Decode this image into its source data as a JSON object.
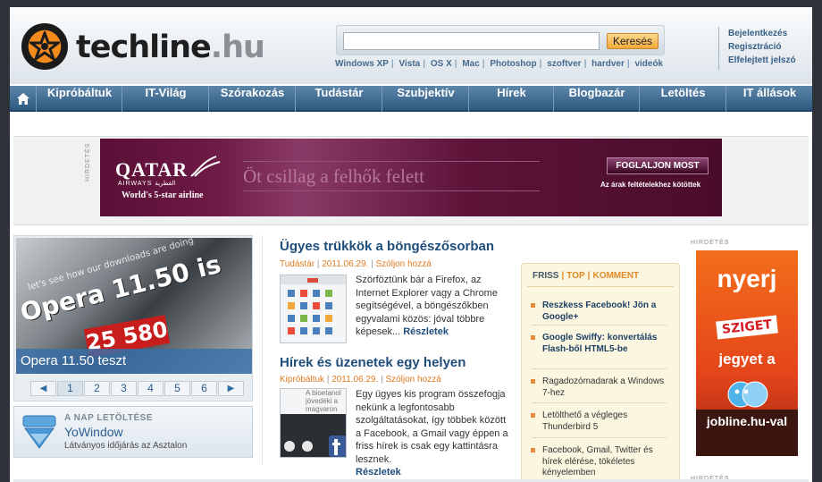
{
  "header": {
    "logo_text": "techline",
    "logo_domain": ".hu",
    "search_placeholder": "",
    "search_button": "Keresés",
    "quick_links": [
      "Windows XP",
      "Vista",
      "OS X",
      "Mac",
      "Photoshop",
      "szoftver",
      "hardver",
      "videók"
    ],
    "account_links": [
      "Bejelentkezés",
      "Regisztráció",
      "Elfelejtett jelszó"
    ]
  },
  "nav": {
    "home_icon": "home-icon",
    "items": [
      "Kipróbáltuk",
      "IT-Világ",
      "Szórakozás",
      "Tudástár",
      "Szubjektív",
      "Hírek",
      "Blogbazár",
      "Letöltés",
      "IT állások"
    ]
  },
  "ad_label": "HIRDETÉS",
  "qatar_ad": {
    "brand": "QATAR",
    "brand_sub": "AIRWAYS القطرية",
    "tagline": "World's 5-star airline",
    "headline": "Öt csillag a felhők felett",
    "cta": "FOGLALJON MOST",
    "note": "Az árak feltételekhez kötöttek"
  },
  "slider": {
    "caption": "Opera 11.50 teszt",
    "image_big_text": "Opera 11.50 is",
    "image_small_text": "let's see how our downloads are doing",
    "image_red_text": "25 580",
    "prev": "◀",
    "next": "▶",
    "pages": [
      "1",
      "2",
      "3",
      "4",
      "5",
      "6"
    ],
    "active_page": "1"
  },
  "download": {
    "label": "A NAP LETÖLTÉSE",
    "title": "YoWindow",
    "subtitle": "Látványos időjárás az Asztalon"
  },
  "articles": [
    {
      "title": "Ügyes trükkök a böngészősorban",
      "category": "Tudástár",
      "date": "2011.06.29.",
      "comment": "Szóljon hozzá",
      "body": "Szörföztünk bár a Firefox, az Internet Explorer vagy a Chrome segítségével, a böngészőkben egyvalami közös: jóval többre képesek...",
      "more": "Részletek"
    },
    {
      "title": "Hírek és üzenetek egy helyen",
      "category": "Kipróbáltuk",
      "date": "2011.06.29.",
      "comment": "Szóljon hozzá",
      "body": "Egy ügyes kis program összefogja nekünk a legfontosabb szolgáltatásokat, így többek között a Facebook, a Gmail vagy éppen a friss hírek is csak egy kattintásra lesznek.",
      "more": "Részletek",
      "thumb_text": "A bioetanol jövedéki a magvaron"
    }
  ],
  "friss": {
    "tabs": [
      "FRISS",
      "TOP",
      "KOMMENT"
    ],
    "active_tab": "FRISS",
    "items": [
      {
        "text": "Reszkess Facebook! Jön a Google+",
        "bold": true
      },
      {
        "text": "Google Swiffy: konvertálás Flash-ből HTML5-be",
        "bold": true
      },
      {
        "text": "Ragadozómadarak a Windows 7-hez",
        "bold": false
      },
      {
        "text": "Letölthető a végleges Thunderbird 5",
        "bold": false
      },
      {
        "text": "Facebook, Gmail, Twitter és hírek elérése, tökéletes kényelemben",
        "bold": false
      }
    ]
  },
  "sziget_ad": {
    "line1": "nyerj",
    "logo": "SZIGET",
    "line2": "jegyet a",
    "line3": "jobline.hu-val"
  },
  "colors": {
    "nav_bg": "#3c6a92",
    "accent_orange": "#e07a1f",
    "link_blue": "#1f4d7a"
  }
}
